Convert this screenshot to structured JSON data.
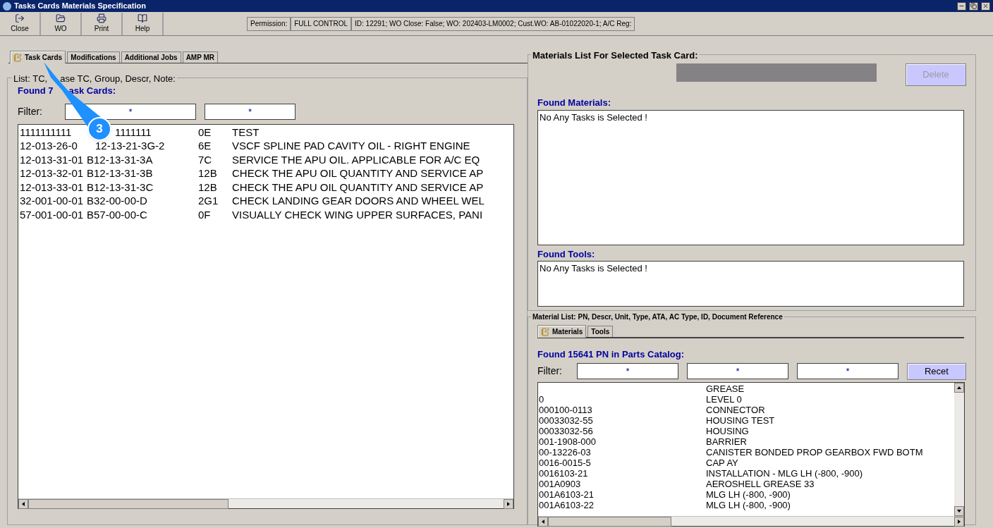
{
  "window": {
    "title": "Tasks Cards Materials Specification"
  },
  "toolbar": {
    "buttons": [
      {
        "label": "Close",
        "kind": "close"
      },
      {
        "label": "WO",
        "kind": "wo"
      },
      {
        "label": "Print",
        "kind": "print"
      },
      {
        "label": "Help",
        "kind": "help"
      }
    ]
  },
  "status": {
    "permission_label": "Permission:",
    "permission_value": "FULL CONTROL",
    "info": "ID: 12291; WO Close: False; WO: 202403-LM0002; Cust.WO: AB-01022020-1; A/C Reg:"
  },
  "tabs": [
    {
      "label": "Task Cards",
      "selected": true
    },
    {
      "label": "Modifications",
      "selected": false
    },
    {
      "label": "Additional Jobs",
      "selected": false
    },
    {
      "label": "AMP MR",
      "selected": false
    }
  ],
  "task_list": {
    "group_title": [
      "List: TC,",
      "ase TC, Group, Descr, Note:"
    ],
    "found": [
      "Found 7",
      "ask Cards:"
    ],
    "filter_label": "Filter:",
    "filters": [
      "*",
      "*"
    ],
    "rows": [
      [
        "1111111111",
        "1111111",
        "0E",
        "TEST"
      ],
      [
        "12-013-26-0",
        "12-13-21-3G-2",
        "6E",
        "VSCF SPLINE PAD CAVITY OIL - RIGHT ENGINE"
      ],
      [
        "12-013-31-01",
        "B12-13-31-3A",
        "7C",
        "SERVICE THE APU OIL. APPLICABLE FOR A/C EQ"
      ],
      [
        "12-013-32-01",
        "B12-13-31-3B",
        "12B",
        "CHECK THE APU OIL QUANTITY AND SERVICE AP"
      ],
      [
        "12-013-33-01",
        "B12-13-31-3C",
        "12B",
        "CHECK THE APU OIL QUANTITY AND SERVICE AP"
      ],
      [
        "32-001-00-01",
        "B32-00-00-D",
        "2G1",
        "CHECK LANDING GEAR DOORS AND WHEEL WEL"
      ],
      [
        "57-001-00-01",
        "B57-00-00-C",
        "0F",
        "VISUALLY CHECK WING UPPER SURFACES, PANI"
      ]
    ]
  },
  "materials_panel": {
    "group_title": "Materials List For Selected Task Card:",
    "delete_button": {
      "label": "Delete",
      "disabled": true
    },
    "found_materials": "Found Materials:",
    "materials_message": "No Any Tasks is Selected !",
    "found_tools": "Found Tools:",
    "tools_message": "No Any Tasks is Selected !"
  },
  "catalog": {
    "group_title": "Material List: PN, Descr, Unit, Type, ATA, AC Type, ID, Document Reference",
    "tabs": [
      {
        "label": "Materials",
        "selected": true
      },
      {
        "label": "Tools",
        "selected": false
      }
    ],
    "found": "Found 15641 PN in Parts Catalog:",
    "filter_label": "Filter:",
    "filters": [
      "*",
      "*",
      "*"
    ],
    "reset_button": {
      "label": "Recet",
      "disabled": false
    },
    "rows": [
      [
        "",
        "GREASE"
      ],
      [
        "0",
        "LEVEL 0"
      ],
      [
        "000100-0113",
        "CONNECTOR"
      ],
      [
        "00033032-55",
        "HOUSING TEST"
      ],
      [
        "00033032-56",
        "HOUSING"
      ],
      [
        "001-1908-000",
        "BARRIER"
      ],
      [
        "00-13226-03",
        "CANISTER BONDED PROP GEARBOX FWD BOTM"
      ],
      [
        "0016-0015-5",
        "CAP AY"
      ],
      [
        "0016103-21",
        "INSTALLATION - MLG LH (-800, -900)"
      ],
      [
        "001A0903",
        "AEROSHELL GREASE 33"
      ],
      [
        "001A6103-21",
        "MLG LH (-800, -900)"
      ],
      [
        "001A6103-22",
        "MLG LH (-800, -900)"
      ]
    ]
  },
  "callout": {
    "label": "3"
  }
}
